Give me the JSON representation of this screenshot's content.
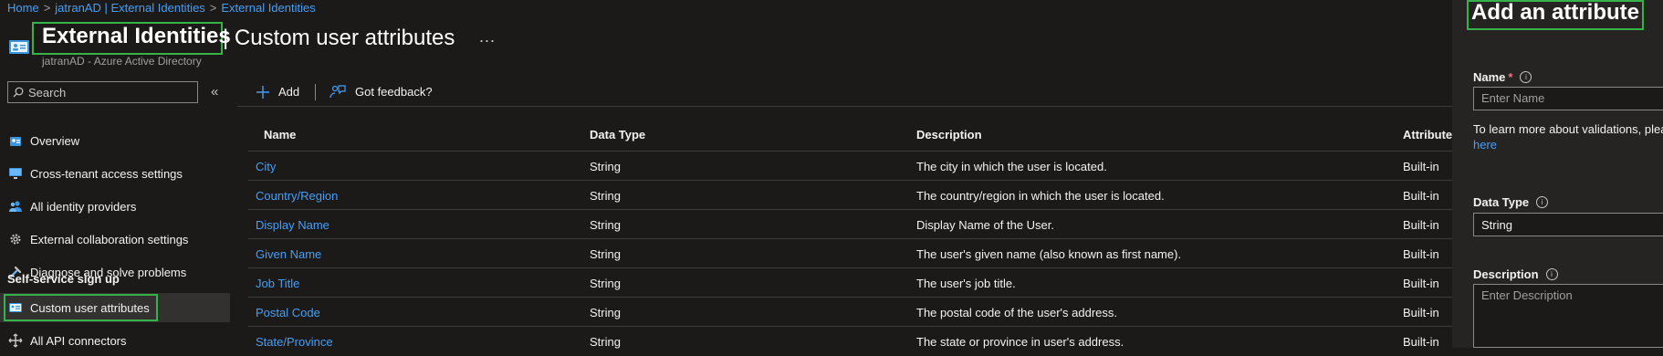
{
  "breadcrumb": {
    "items": [
      "Home",
      "jatranAD | External Identities",
      "External Identities"
    ],
    "separator": ">"
  },
  "header": {
    "title": "External Identities",
    "title_sep": "|",
    "subtitle_page": "Custom user attributes",
    "directory": "jatranAD - Azure Active Directory",
    "more": "..."
  },
  "sidebar": {
    "search_placeholder": "Search",
    "collapse_glyph": "«",
    "items": [
      {
        "label": "Overview",
        "icon": "overview-icon"
      },
      {
        "label": "Cross-tenant access settings",
        "icon": "monitor-icon"
      },
      {
        "label": "All identity providers",
        "icon": "users-icon"
      },
      {
        "label": "External collaboration settings",
        "icon": "gear-icon"
      },
      {
        "label": "Diagnose and solve problems",
        "icon": "wrench-icon"
      }
    ],
    "section": "Self-service sign up",
    "section_items": [
      {
        "label": "Custom user attributes",
        "icon": "id-card-icon",
        "active": true
      },
      {
        "label": "All API connectors",
        "icon": "arrows-icon"
      }
    ]
  },
  "toolbar": {
    "add_label": "Add",
    "feedback_label": "Got feedback?"
  },
  "table": {
    "columns": [
      "Name",
      "Data Type",
      "Description",
      "Attribute"
    ],
    "rows": [
      {
        "name": "City",
        "type": "String",
        "description": "The city in which the user is located.",
        "attribute": "Built-in"
      },
      {
        "name": "Country/Region",
        "type": "String",
        "description": "The country/region in which the user is located.",
        "attribute": "Built-in"
      },
      {
        "name": "Display Name",
        "type": "String",
        "description": "Display Name of the User.",
        "attribute": "Built-in"
      },
      {
        "name": "Given Name",
        "type": "String",
        "description": "The user's given name (also known as first name).",
        "attribute": "Built-in"
      },
      {
        "name": "Job Title",
        "type": "String",
        "description": "The user's job title.",
        "attribute": "Built-in"
      },
      {
        "name": "Postal Code",
        "type": "String",
        "description": "The postal code of the user's address.",
        "attribute": "Built-in"
      },
      {
        "name": "State/Province",
        "type": "String",
        "description": "The state or province in user's address.",
        "attribute": "Built-in"
      }
    ]
  },
  "panel": {
    "title": "Add an attribute",
    "name_label": "Name",
    "required_mark": "*",
    "name_placeholder": "Enter Name",
    "validation_note": "To learn more about validations, plea",
    "validation_link": "here",
    "data_type_label": "Data Type",
    "data_type_value": "String",
    "description_label": "Description",
    "description_placeholder": "Enter Description",
    "info_glyph": "i"
  },
  "colors": {
    "background": "#1b1a19",
    "panel": "#252423",
    "link": "#479ef5",
    "highlight": "#36b24a",
    "required": "#f1707b"
  }
}
